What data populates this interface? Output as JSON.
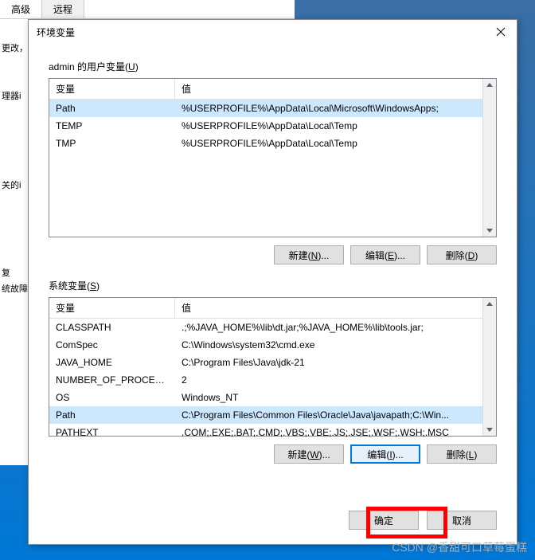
{
  "bgTabs": {
    "advanced": "高级",
    "remote": "远程"
  },
  "bgLabels": {
    "l1": "更改，",
    "l2": "理器i",
    "l3": "关的i",
    "l4": "复",
    "l5": "统故障"
  },
  "dialog": {
    "title": "环境变量",
    "close_icon": "close",
    "userVars": {
      "label_pre": "admin 的用户变量(",
      "label_key": "U",
      "label_post": ")",
      "headers": {
        "var": "变量",
        "val": "值"
      },
      "rows": [
        {
          "var": "Path",
          "val": "%USERPROFILE%\\AppData\\Local\\Microsoft\\WindowsApps;",
          "selected": true
        },
        {
          "var": "TEMP",
          "val": "%USERPROFILE%\\AppData\\Local\\Temp"
        },
        {
          "var": "TMP",
          "val": "%USERPROFILE%\\AppData\\Local\\Temp"
        }
      ],
      "buttons": {
        "new": "新建(N)...",
        "edit": "编辑(E)...",
        "delete": "删除(D)"
      }
    },
    "sysVars": {
      "label_pre": "系统变量(",
      "label_key": "S",
      "label_post": ")",
      "headers": {
        "var": "变量",
        "val": "值"
      },
      "rows": [
        {
          "var": "CLASSPATH",
          "val": ".;%JAVA_HOME%\\lib\\dt.jar;%JAVA_HOME%\\lib\\tools.jar;"
        },
        {
          "var": "ComSpec",
          "val": "C:\\Windows\\system32\\cmd.exe"
        },
        {
          "var": "JAVA_HOME",
          "val": "C:\\Program Files\\Java\\jdk-21"
        },
        {
          "var": "NUMBER_OF_PROCESSORS",
          "val": "2"
        },
        {
          "var": "OS",
          "val": "Windows_NT"
        },
        {
          "var": "Path",
          "val": "C:\\Program Files\\Common Files\\Oracle\\Java\\javapath;C:\\Win...",
          "selected": true
        },
        {
          "var": "PATHEXT",
          "val": ".COM;.EXE;.BAT;.CMD;.VBS;.VBE;.JS;.JSE;.WSF;.WSH;.MSC"
        }
      ],
      "buttons": {
        "new": "新建(W)...",
        "edit": "编辑(I)...",
        "delete": "删除(L)"
      }
    },
    "ok": "确定",
    "cancel": "取消"
  },
  "watermark": "CSDN @香甜可口草莓蛋糕"
}
